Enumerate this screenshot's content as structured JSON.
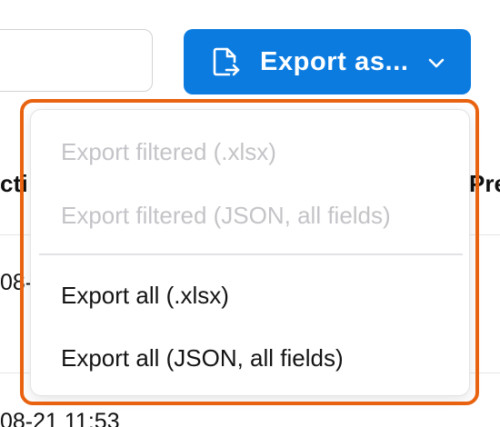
{
  "toolbar": {
    "search_value": "",
    "export_button_label": "Export as...",
    "export_icon": "file-export-icon",
    "chevron_icon": "chevron-down-icon",
    "accent_color": "#0b7be0"
  },
  "table": {
    "header_left_fragment": "cti",
    "header_right_fragment": "Pre",
    "row_1_fragment": "08-",
    "row_2_fragment": "08-21 11:53"
  },
  "export_menu": {
    "items": [
      {
        "label": "Export filtered (.xlsx)",
        "enabled": false
      },
      {
        "label": "Export filtered (JSON, all fields)",
        "enabled": false
      },
      {
        "label": "Export all (.xlsx)",
        "enabled": true
      },
      {
        "label": "Export all (JSON, all fields)",
        "enabled": true
      }
    ],
    "highlight_color": "#e8620f"
  }
}
